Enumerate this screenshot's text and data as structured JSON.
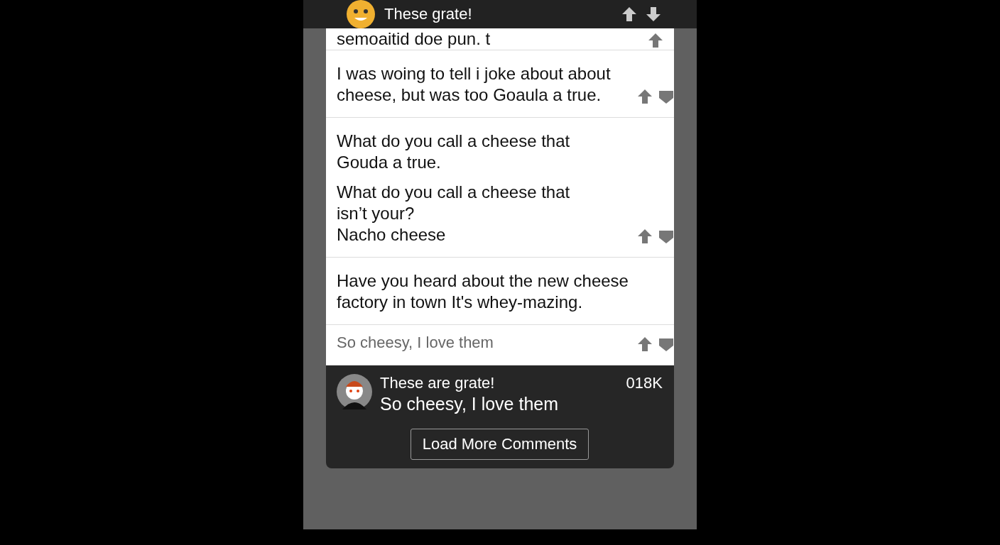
{
  "header": {
    "title": "These grate!"
  },
  "comments": [
    {
      "kind": "clipped",
      "lines": [
        "semoaitid doe pun. t"
      ],
      "votes": true
    },
    {
      "kind": "normal",
      "lines": [
        "I was woing to tell i joke about about cheese, but was too Goaula a true."
      ],
      "votes": true
    },
    {
      "kind": "normal",
      "lines": [
        "What do you call a cheese that\nGouda a true.",
        "What do you call a cheese that\nisn’t your?\nNacho cheese"
      ],
      "votes": true
    },
    {
      "kind": "normal",
      "lines": [
        "Have you heard about the new cheese factory in town It's whey-mazing."
      ],
      "votes": false
    },
    {
      "kind": "muted",
      "lines": [
        "So cheesy, I love them"
      ],
      "votes": true
    }
  ],
  "featured": {
    "title": "These are grate!",
    "body": "So cheesy, I love them",
    "count": "018K"
  },
  "load_more": "Load More Comments"
}
